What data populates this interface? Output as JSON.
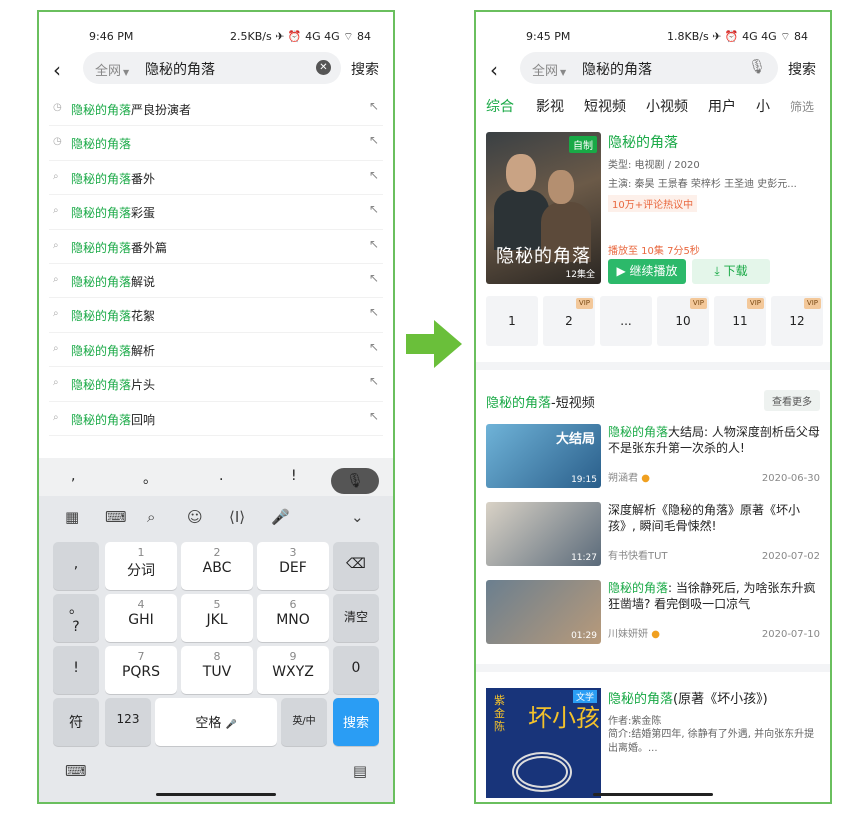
{
  "left": {
    "status": {
      "time": "9:46 PM",
      "right": "2.5KB/s ✈ ⏰ 4G 4G ⌔ 84"
    },
    "search": {
      "scope": "全网",
      "query": "隐秘的角落",
      "button": "搜索"
    },
    "suggestions": [
      {
        "icon": "history",
        "hl": "隐秘的角落",
        "rest": "严良扮演者"
      },
      {
        "icon": "history",
        "hl": "隐秘的角落",
        "rest": ""
      },
      {
        "icon": "search",
        "hl": "隐秘的角落",
        "rest": "番外"
      },
      {
        "icon": "search",
        "hl": "隐秘的角落",
        "rest": "彩蛋"
      },
      {
        "icon": "search",
        "hl": "隐秘的角落",
        "rest": "番外篇"
      },
      {
        "icon": "search",
        "hl": "隐秘的角落",
        "rest": "解说"
      },
      {
        "icon": "search",
        "hl": "隐秘的角落",
        "rest": "花絮"
      },
      {
        "icon": "search",
        "hl": "隐秘的角落",
        "rest": "解析"
      },
      {
        "icon": "search",
        "hl": "隐秘的角落",
        "rest": "片头"
      },
      {
        "icon": "search",
        "hl": "隐秘的角落",
        "rest": "回响"
      }
    ],
    "keyboard": {
      "punct": [
        ",",
        "。",
        ".",
        "!"
      ],
      "keys": {
        "comma": ",",
        "period_q": "。\n?",
        "excl": "!",
        "k1n": "1",
        "k1": "分词",
        "k2n": "2",
        "k2": "ABC",
        "k3n": "3",
        "k3": "DEF",
        "k4n": "4",
        "k4": "GHI",
        "k5n": "5",
        "k5": "JKL",
        "k6n": "6",
        "k6": "MNO",
        "k7n": "7",
        "k7": "PQRS",
        "k8n": "8",
        "k8": "TUV",
        "k9n": "9",
        "k9": "WXYZ",
        "clear": "清空",
        "zero": "0",
        "sym": "符",
        "num": "123",
        "space": "空格",
        "lang": "英/中",
        "search": "搜索"
      }
    }
  },
  "right": {
    "status": {
      "time": "9:45 PM",
      "right": "1.8KB/s ✈ ⏰ 4G 4G ⌔ 84"
    },
    "search": {
      "scope": "全网",
      "query": "隐秘的角落",
      "button": "搜索"
    },
    "tabs": [
      "综合",
      "影视",
      "短视频",
      "小视频",
      "用户",
      "小"
    ],
    "filter": "筛选",
    "show": {
      "badge": "自制",
      "poster_title": "隐秘的角落",
      "episodes_total": "12集全",
      "title": "隐秘的角落",
      "type": "类型: 电视剧 / 2020",
      "cast": "主演: 秦昊 王景春 荣梓杉 王圣迪 史彭元...",
      "hot": "10万+评论热议中",
      "progress": "播放至 10集 7分5秒",
      "play": "继续播放",
      "download": "下载"
    },
    "episodes": [
      {
        "label": "1",
        "vip": ""
      },
      {
        "label": "2",
        "vip": "VIP"
      },
      {
        "label": "...",
        "vip": ""
      },
      {
        "label": "10",
        "vip": "VIP"
      },
      {
        "label": "11",
        "vip": "VIP"
      },
      {
        "label": "12",
        "vip": "VIP"
      }
    ],
    "short_section": {
      "title_hl": "隐秘的角落",
      "title_rest": "-短视频",
      "more": "查看更多"
    },
    "videos": [
      {
        "thumb_tag": "大结局",
        "duration": "19:15",
        "title_hl": "隐秘的角落",
        "title_rest": "大结局: 人物深度剖析岳父母不是张东升第一次杀的人!",
        "author": "朔涵君",
        "date": "2020-06-30"
      },
      {
        "thumb_tag": "",
        "duration": "11:27",
        "title_hl": "",
        "title_rest": "深度解析《隐秘的角落》原著《坏小孩》, 瞬间毛骨悚然!",
        "author": "有书快看TUT",
        "date": "2020-07-02"
      },
      {
        "thumb_tag": "",
        "duration": "01:29",
        "title_hl": "隐秘的角落",
        "title_rest": ": 当徐静死后, 为啥张东升疯狂凿墙? 看完倒吸一口凉气",
        "author": "川妹妍妍",
        "date": "2020-07-10"
      }
    ],
    "book": {
      "label": "文学",
      "cover_title": "坏小孩",
      "cover_author": "紫金陈",
      "title_hl": "隐秘的角落",
      "title_rest": "(原著《坏小孩》)",
      "author": "作者:紫金陈",
      "desc": "简介:结婚第四年, 徐静有了外遇, 并向张东升提出离婚。..."
    }
  }
}
